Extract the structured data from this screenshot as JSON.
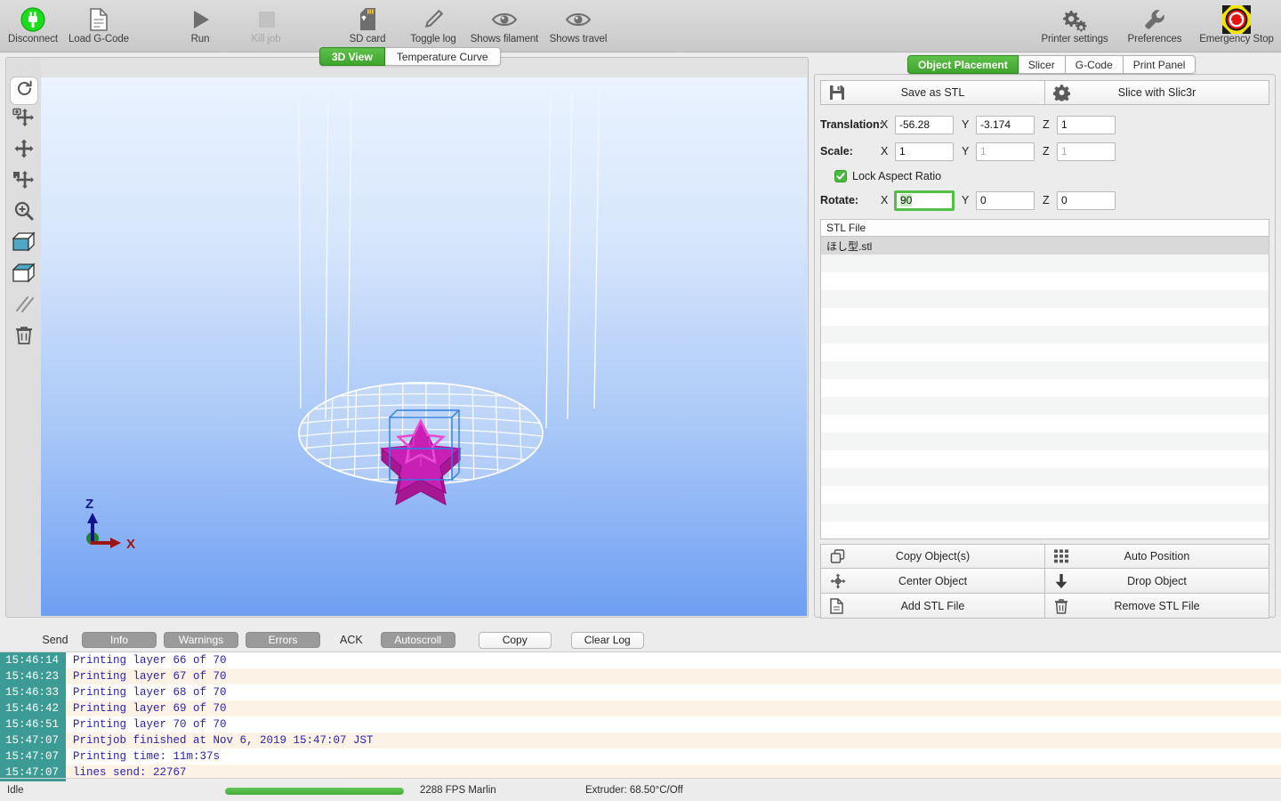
{
  "toolbar": {
    "items": [
      {
        "id": "disconnect",
        "label": "Disconnect",
        "icon": "plug-icon",
        "disabled": false
      },
      {
        "id": "load-gcode",
        "label": "Load G-Code",
        "icon": "document-icon",
        "disabled": false
      },
      {
        "id": "run",
        "label": "Run",
        "icon": "play-icon",
        "disabled": false
      },
      {
        "id": "kill-job",
        "label": "Kill job",
        "icon": "stop-square-icon",
        "disabled": true
      },
      {
        "id": "sd-card",
        "label": "SD card",
        "icon": "sd-card-icon",
        "disabled": false
      },
      {
        "id": "toggle-log",
        "label": "Toggle log",
        "icon": "pencil-icon",
        "disabled": false
      },
      {
        "id": "shows-filament",
        "label": "Shows filament",
        "icon": "eye-icon",
        "disabled": false
      },
      {
        "id": "shows-travel",
        "label": "Shows travel",
        "icon": "eye-icon",
        "disabled": false
      },
      {
        "id": "printer-settings",
        "label": "Printer settings",
        "icon": "gears-icon",
        "disabled": false
      },
      {
        "id": "preferences",
        "label": "Preferences",
        "icon": "wrench-icon",
        "disabled": false
      },
      {
        "id": "emergency-stop",
        "label": "Emergency Stop",
        "icon": "emergency-stop-icon",
        "disabled": false
      }
    ]
  },
  "view": {
    "tabs": [
      {
        "label": "3D View",
        "active": true
      },
      {
        "label": "Temperature Curve",
        "active": false
      }
    ],
    "tools": [
      {
        "name": "reset-view-tool",
        "icon": "refresh-icon",
        "selected": true
      },
      {
        "name": "move-camera-tool",
        "icon": "camera-move-icon",
        "selected": false
      },
      {
        "name": "pan-tool",
        "icon": "move-arrows-icon",
        "selected": false
      },
      {
        "name": "move-object-tool",
        "icon": "object-move-icon",
        "selected": false
      },
      {
        "name": "zoom-tool",
        "icon": "magnifier-plus-icon",
        "selected": false
      },
      {
        "name": "solid-view-tool",
        "icon": "solid-box-icon",
        "selected": false
      },
      {
        "name": "wireframe-view-tool",
        "icon": "wireframe-box-icon",
        "selected": false
      },
      {
        "name": "travel-lines-tool",
        "icon": "diagonal-lines-icon",
        "selected": false
      },
      {
        "name": "delete-tool",
        "icon": "trash-icon",
        "selected": false
      }
    ],
    "axes": {
      "z": "Z",
      "x": "X"
    },
    "model": {
      "name": "star-object",
      "color": "#c81fb4",
      "selection_color": "#2f7fe0"
    },
    "bed": {
      "shape": "circular",
      "grid_color": "#ffffff"
    }
  },
  "right_panel": {
    "tabs": [
      {
        "label": "Object Placement",
        "active": true
      },
      {
        "label": "Slicer",
        "active": false
      },
      {
        "label": "G-Code",
        "active": false
      },
      {
        "label": "Print Panel",
        "active": false
      }
    ],
    "actions": [
      {
        "label": "Save as STL",
        "icon": "floppy-disk-icon"
      },
      {
        "label": "Slice with Slic3r",
        "icon": "gear-icon"
      }
    ],
    "fields": {
      "translation": {
        "label": "Translation:",
        "x_axis": "X",
        "y_axis": "Y",
        "z_axis": "Z",
        "x": "-56.28",
        "y": "-3.174",
        "z": "1",
        "x_disabled": false,
        "y_disabled": false,
        "z_disabled": false
      },
      "scale": {
        "label": "Scale:",
        "x_axis": "X",
        "y_axis": "Y",
        "z_axis": "Z",
        "x": "1",
        "y": "1",
        "z": "1",
        "x_disabled": false,
        "y_disabled": true,
        "z_disabled": true
      },
      "rotate": {
        "label": "Rotate:",
        "x_axis": "X",
        "y_axis": "Y",
        "z_axis": "Z",
        "x": "90",
        "y": "0",
        "z": "0",
        "x_focused": true
      }
    },
    "lock_aspect_ratio": {
      "label": "Lock Aspect Ratio",
      "checked": true
    },
    "stl_list": {
      "header": "STL File",
      "rows": [
        {
          "name": "ほし型.stl",
          "selected": true
        },
        {
          "name": "",
          "selected": false
        },
        {
          "name": "",
          "selected": false
        },
        {
          "name": "",
          "selected": false
        },
        {
          "name": "",
          "selected": false
        },
        {
          "name": "",
          "selected": false
        },
        {
          "name": "",
          "selected": false
        },
        {
          "name": "",
          "selected": false
        },
        {
          "name": "",
          "selected": false
        },
        {
          "name": "",
          "selected": false
        },
        {
          "name": "",
          "selected": false
        },
        {
          "name": "",
          "selected": false
        },
        {
          "name": "",
          "selected": false
        },
        {
          "name": "",
          "selected": false
        },
        {
          "name": "",
          "selected": false
        },
        {
          "name": "",
          "selected": false
        },
        {
          "name": "",
          "selected": false
        }
      ]
    },
    "object_buttons": [
      {
        "label": "Copy Object(s)",
        "icon": "copy-icon"
      },
      {
        "label": "Auto Position",
        "icon": "grid-dots-icon"
      },
      {
        "label": "Center Object",
        "icon": "center-arrows-icon"
      },
      {
        "label": "Drop Object",
        "icon": "arrow-down-icon"
      },
      {
        "label": "Add STL File",
        "icon": "document-add-icon"
      },
      {
        "label": "Remove STL File",
        "icon": "trash-icon"
      }
    ]
  },
  "log_controls": {
    "send_label": "Send",
    "ack_label": "ACK",
    "toggles": [
      {
        "label": "Info",
        "on": true
      },
      {
        "label": "Warnings",
        "on": true
      },
      {
        "label": "Errors",
        "on": true
      }
    ],
    "autoscroll": {
      "label": "Autoscroll",
      "on": true
    },
    "buttons": [
      {
        "label": "Copy"
      },
      {
        "label": "Clear Log"
      }
    ]
  },
  "log": {
    "entries": [
      {
        "time": "15:46:14",
        "message": "Printing layer 66 of 70"
      },
      {
        "time": "15:46:23",
        "message": "Printing layer 67 of 70"
      },
      {
        "time": "15:46:33",
        "message": "Printing layer 68 of 70"
      },
      {
        "time": "15:46:42",
        "message": "Printing layer 69 of 70"
      },
      {
        "time": "15:46:51",
        "message": "Printing layer 70 of 70"
      },
      {
        "time": "15:47:07",
        "message": "Printjob finished at Nov 6, 2019 15:47:07 JST"
      },
      {
        "time": "15:47:07",
        "message": "Printing time: 11m:37s"
      },
      {
        "time": "15:47:07",
        "message": "lines send: 22767"
      }
    ]
  },
  "status_bar": {
    "state": "Idle",
    "progress_percent": 100,
    "fps": "2288 FPS Marlin",
    "extruder": "Extruder: 68.50°C/Off"
  },
  "colors": {
    "accent_green": "#45ab38",
    "log_time_bg": "#3d9b95",
    "log_text": "#2a22b8",
    "model": "#c81fb4"
  }
}
